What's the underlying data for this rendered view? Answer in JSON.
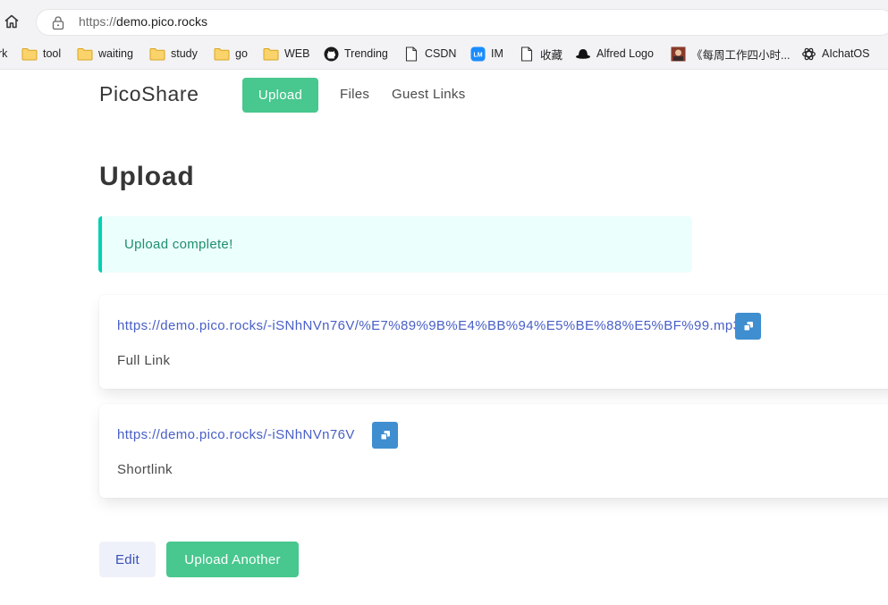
{
  "browser": {
    "url_proto": "https://",
    "url_host": "demo.pico.rocks",
    "bookmarks": [
      {
        "label": "rk",
        "icon": "none"
      },
      {
        "label": "tool",
        "icon": "folder-icon"
      },
      {
        "label": "waiting",
        "icon": "folder-icon"
      },
      {
        "label": "study",
        "icon": "folder-icon"
      },
      {
        "label": "go",
        "icon": "folder-icon"
      },
      {
        "label": "WEB",
        "icon": "folder-icon"
      },
      {
        "label": "Trending",
        "icon": "github-icon"
      },
      {
        "label": "CSDN",
        "icon": "page-icon"
      },
      {
        "label": "IM",
        "icon": "lm-icon"
      },
      {
        "label": "收藏",
        "icon": "page-icon"
      },
      {
        "label": "Alfred Logo",
        "icon": "hat-icon"
      },
      {
        "label": "《每周工作四小时...",
        "icon": "book-cover-icon"
      },
      {
        "label": "AIchatOS",
        "icon": "openai-icon"
      }
    ]
  },
  "nav": {
    "brand": "PicoShare",
    "upload": "Upload",
    "files": "Files",
    "guest_links": "Guest Links"
  },
  "main": {
    "title": "Upload",
    "notice": "Upload complete!",
    "full_link": "https://demo.pico.rocks/-iSNhNVn76V/%E7%89%9B%E4%BB%94%E5%BE%88%E5%BF%99.mp3",
    "full_link_label": "Full Link",
    "short_link": "https://demo.pico.rocks/-iSNhNVn76V",
    "short_link_label": "Shortlink",
    "edit_button": "Edit",
    "upload_another_button": "Upload Another"
  },
  "colors": {
    "primary_green": "#48c78e",
    "link_blue": "#485fc7",
    "info_blue": "#3e8ed0",
    "notice_bg": "#ebfffc",
    "notice_border": "#00d1b2"
  }
}
